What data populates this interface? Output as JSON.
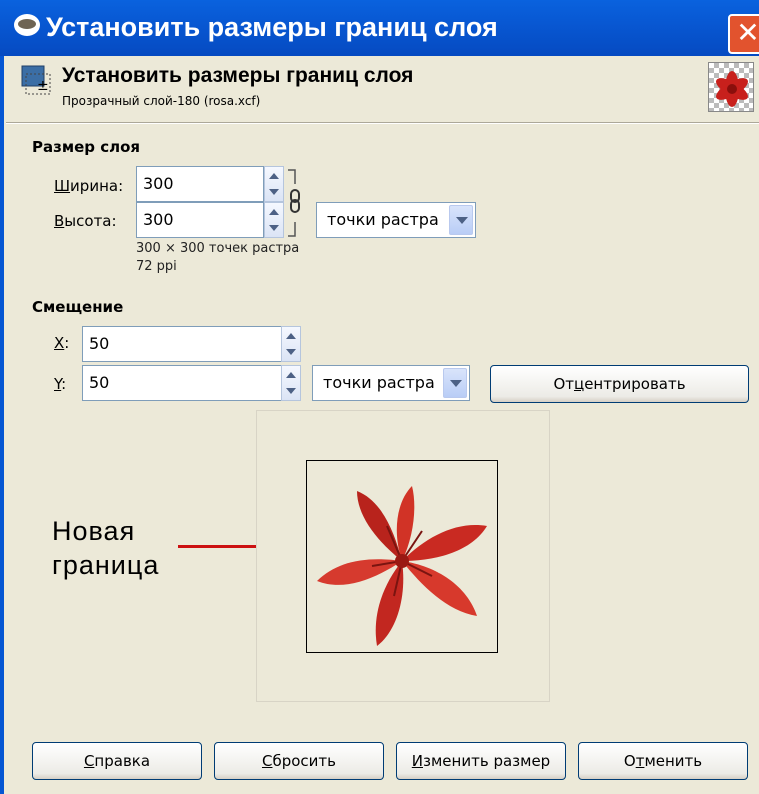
{
  "window": {
    "title": "Установить размеры границ слоя",
    "close_glyph": "✕",
    "app_icon": "gimp-wilber-icon"
  },
  "header": {
    "icon": "layer-resize-icon",
    "title": "Установить размеры границ слоя",
    "subtitle": "Прозрачный слой-180 (rosa.xcf)",
    "thumbnail": "red-lily-thumbnail"
  },
  "layer_size": {
    "section_title": "Размер слоя",
    "width_label_accel": "Ш",
    "width_label_rest": "ирина:",
    "width_value": "300",
    "height_label_accel": "В",
    "height_label_rest": "ысота:",
    "height_value": "300",
    "chain_icon": "chain-link-icon",
    "unit": "точки растра",
    "info_size": "300 × 300 точек растра",
    "info_resolution": "72 ppi"
  },
  "offset": {
    "section_title": "Смещение",
    "x_label_accel": "X",
    "x_label_rest": ":",
    "x_value": "50",
    "y_label_accel": "Y",
    "y_label_rest": ":",
    "y_value": "50",
    "unit": "точки растра",
    "center_button_pre": "От",
    "center_button_accel": "ц",
    "center_button_post": "ентрировать"
  },
  "preview": {
    "image": "red-lily-flower",
    "annotation_line1": "Новая",
    "annotation_line2": "граница",
    "colors": {
      "annotation_line": "#cc1111",
      "flower": "#d8322a"
    }
  },
  "buttons": {
    "help_accel": "С",
    "help_rest": "правка",
    "reset_accel": "С",
    "reset_rest": "бросить",
    "resize_accel": "И",
    "resize_rest": "зменить размер",
    "cancel_pre": "О",
    "cancel_accel": "т",
    "cancel_rest": "менить"
  }
}
